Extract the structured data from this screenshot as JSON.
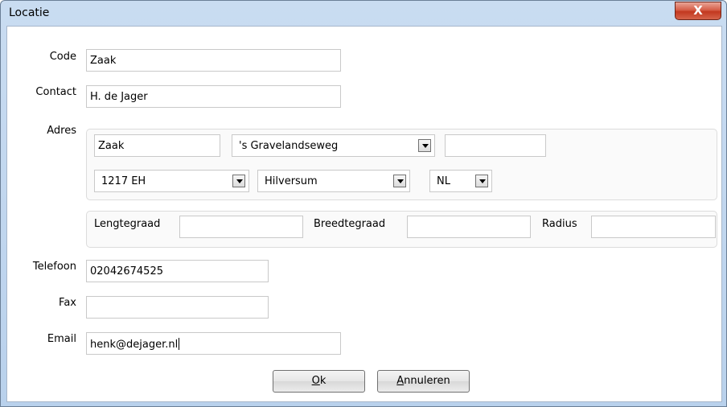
{
  "window": {
    "title": "Locatie",
    "close_label": "X"
  },
  "form": {
    "code": {
      "label": "Code",
      "value": "Zaak"
    },
    "contact": {
      "label": "Contact",
      "value": "H. de Jager"
    },
    "adres": {
      "label": "Adres",
      "naam": "Zaak",
      "straat": "'s Gravelandseweg",
      "huisnummer": "",
      "postcode": "1217 EH",
      "plaats": "Hilversum",
      "land": "NL"
    },
    "coords": {
      "lengtegraad_label": "Lengtegraad",
      "lengtegraad_value": "",
      "breedtegraad_label": "Breedtegraad",
      "breedtegraad_value": "",
      "radius_label": "Radius",
      "radius_value": ""
    },
    "telefoon": {
      "label": "Telefoon",
      "value": "02042674525"
    },
    "fax": {
      "label": "Fax",
      "value": ""
    },
    "email": {
      "label": "Email",
      "value": "henk@dejager.nl"
    }
  },
  "buttons": {
    "ok_mnemonic": "O",
    "ok_rest": "k",
    "cancel_mnemonic": "A",
    "cancel_rest": "nnuleren"
  }
}
